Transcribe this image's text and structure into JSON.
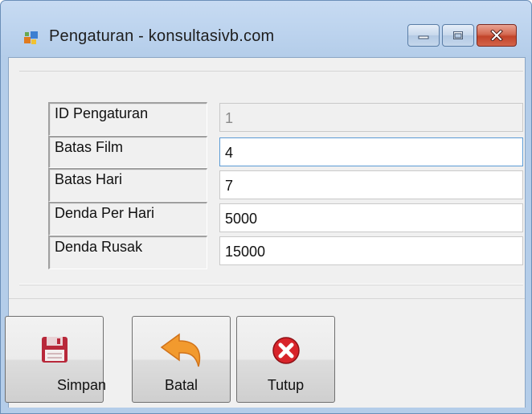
{
  "window": {
    "title": "Pengaturan - konsultasivb.com",
    "controls": [
      "minimize",
      "maximize",
      "close"
    ],
    "icon": "app-window-icon"
  },
  "form": {
    "fields": [
      {
        "label": "ID Pengaturan",
        "value": "1",
        "readonly": true
      },
      {
        "label": "Batas Film",
        "value": "4",
        "readonly": false
      },
      {
        "label": "Batas Hari",
        "value": "7",
        "readonly": false
      },
      {
        "label": "Denda Per Hari",
        "value": "5000",
        "readonly": false
      },
      {
        "label": "Denda Rusak",
        "value": "15000",
        "readonly": false
      }
    ]
  },
  "buttons": {
    "save": {
      "label": "Simpan",
      "icon": "floppy-disk-icon"
    },
    "cancel": {
      "label": "Batal",
      "icon": "undo-arrow-icon"
    },
    "close": {
      "label": "Tutup",
      "icon": "red-x-icon"
    }
  },
  "colors": {
    "titlebar": "#bcd3ee",
    "client": "#f0f0f0",
    "close_button": "#c2442a"
  }
}
